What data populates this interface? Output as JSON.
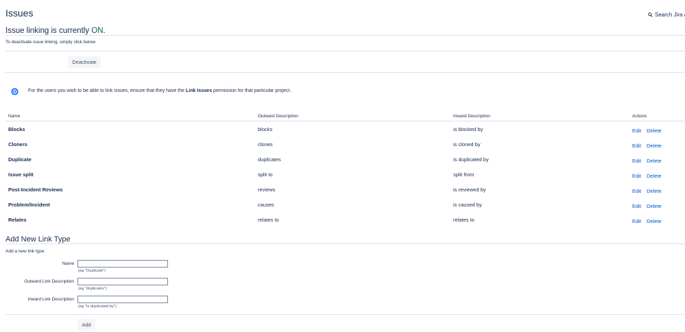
{
  "header": {
    "title": "Issues",
    "search_label": "Search Jira a"
  },
  "status": {
    "prefix": "Issue linking is currently ",
    "state": "ON",
    "suffix": ".",
    "instruction": "To deactivate issue linking, simply click below.",
    "deactivate_label": "Deactivate"
  },
  "info": {
    "before": "For the users you wish to be able to link issues, ensure that they have the ",
    "permission": "Link Issues",
    "after": " permission for that particular project."
  },
  "table": {
    "headers": {
      "name": "Name",
      "outward": "Outward Description",
      "inward": "Inward Description",
      "actions": "Actions"
    },
    "edit_label": "Edit",
    "delete_label": "Delete",
    "rows": [
      {
        "name": "Blocks",
        "outward": "blocks",
        "inward": "is blocked by"
      },
      {
        "name": "Cloners",
        "outward": "clones",
        "inward": "is cloned by"
      },
      {
        "name": "Duplicate",
        "outward": "duplicates",
        "inward": "is duplicated by"
      },
      {
        "name": "Issue split",
        "outward": "split to",
        "inward": "split from"
      },
      {
        "name": "Post-Incident Reviews",
        "outward": "reviews",
        "inward": "is reviewed by"
      },
      {
        "name": "Problem/Incident",
        "outward": "causes",
        "inward": "is caused by"
      },
      {
        "name": "Relates",
        "outward": "relates to",
        "inward": "relates to"
      }
    ]
  },
  "add_form": {
    "heading": "Add New Link Type",
    "subheading": "Add a new link type",
    "fields": {
      "name": {
        "label": "Name",
        "value": "",
        "hint": "(eg \"Duplicate\")"
      },
      "outward": {
        "label": "Outward Link Description",
        "value": "",
        "hint": "(eg \"duplicates\")"
      },
      "inward": {
        "label": "Inward Link Description",
        "value": "",
        "hint": "(eg \"is duplicated by\")"
      }
    },
    "add_label": "Add"
  },
  "icons": {
    "search": "search-icon",
    "info": "info-icon"
  },
  "colors": {
    "text": "#172b4d",
    "link": "#0052cc",
    "on": "#006644",
    "info": "#0065ff",
    "button_bg": "#f4f5f7"
  }
}
